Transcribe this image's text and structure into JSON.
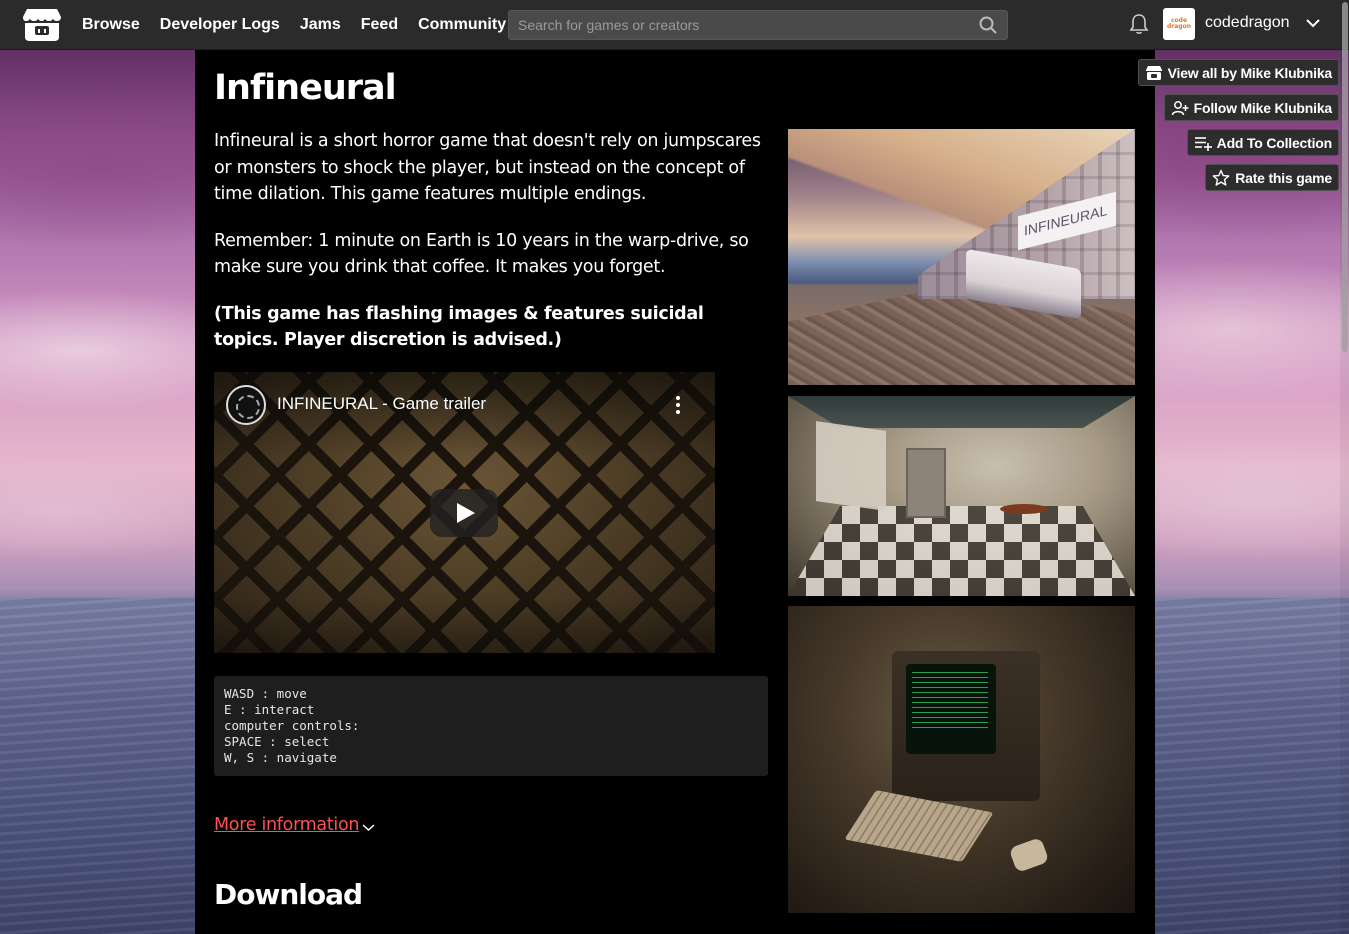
{
  "nav": {
    "links": [
      "Browse",
      "Developer Logs",
      "Jams",
      "Feed",
      "Community"
    ],
    "search_placeholder": "Search for games or creators",
    "username": "codedragon",
    "avatar_text": [
      "code",
      "dragon"
    ]
  },
  "game": {
    "title": "Infineural",
    "description": [
      "Infineural is a short horror game that doesn't rely on jumpscares or monsters to shock the player, but instead on the concept of time dilation. This game features multiple endings.",
      "Remember: 1 minute on Earth is 10 years in the warp-drive, so make sure you drink that coffee. It makes you forget.",
      "(This game has flashing images & features suicidal topics. Player discretion is advised.)"
    ],
    "video_title": "INFINEURAL - Game trailer",
    "controls": "WASD : move\nE : interact\ncomputer controls:\nSPACE : select\nW, S : navigate",
    "more_info": "More information",
    "download_heading": "Download",
    "screenshot_sign": "INFINEURAL"
  },
  "side": {
    "view_all": "View all by Mike Klubnika",
    "follow": "Follow Mike Klubnika",
    "add_collection": "Add To Collection",
    "rate": "Rate this game"
  },
  "colors": {
    "topbar": "#2b2b2b",
    "link_accent": "#ff5050",
    "page_bg": "#000000"
  }
}
